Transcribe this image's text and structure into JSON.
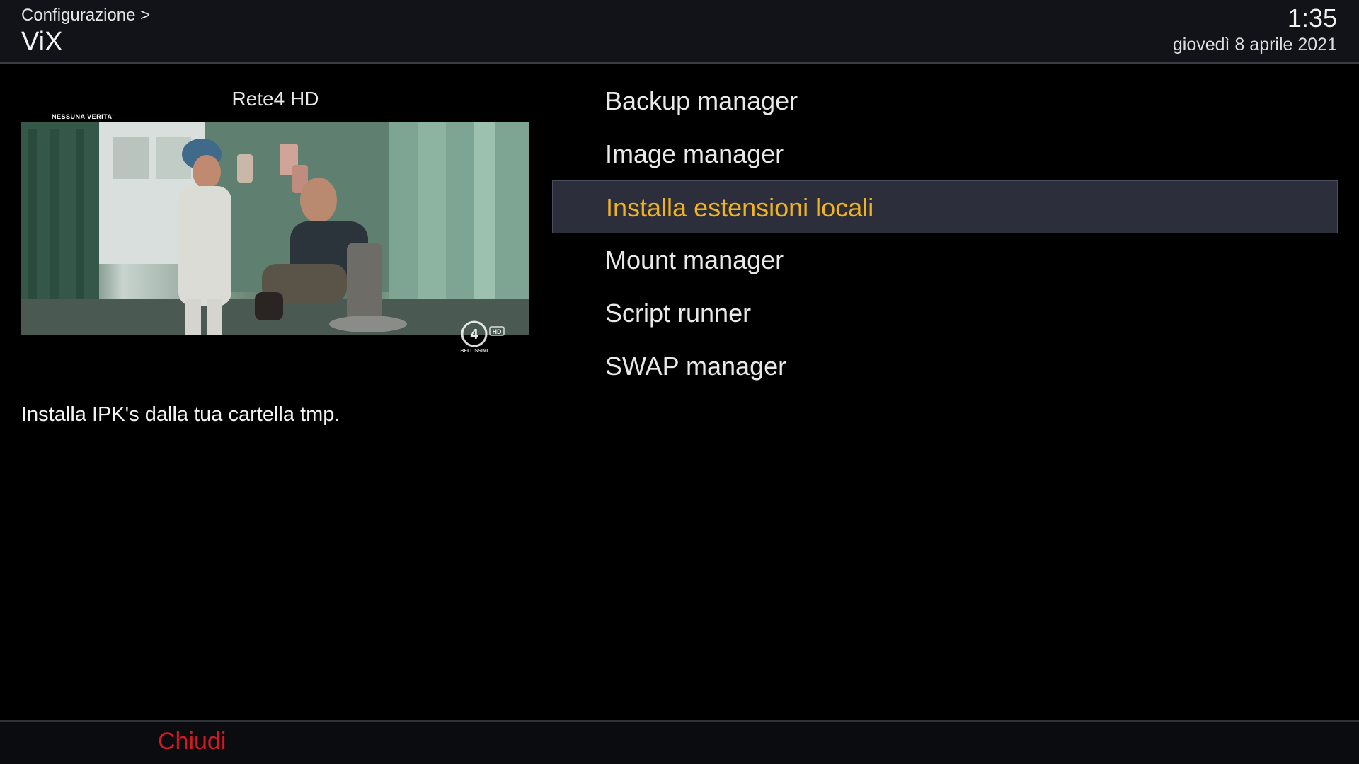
{
  "header": {
    "breadcrumb": "Configurazione >",
    "title": "ViX",
    "clock": "1:35",
    "date": "giovedì 8 aprile 2021"
  },
  "preview": {
    "channel_name": "Rete4 HD",
    "overlay_text": "NESSUNA VERITA'",
    "logo_text": "BELLISSIMI",
    "logo_badge": "HD"
  },
  "menu": {
    "items": [
      {
        "label": "Backup manager",
        "selected": false
      },
      {
        "label": "Image manager",
        "selected": false
      },
      {
        "label": "Installa estensioni locali",
        "selected": true
      },
      {
        "label": "Mount manager",
        "selected": false
      },
      {
        "label": "Script runner",
        "selected": false
      },
      {
        "label": "SWAP manager",
        "selected": false
      }
    ]
  },
  "description": "Installa IPK's dalla tua cartella tmp.",
  "footer": {
    "red_label": "Chiudi"
  },
  "colors": {
    "selected_text": "#f0b323",
    "selected_bg": "#2c2e3b",
    "red_button": "#d11b24"
  }
}
